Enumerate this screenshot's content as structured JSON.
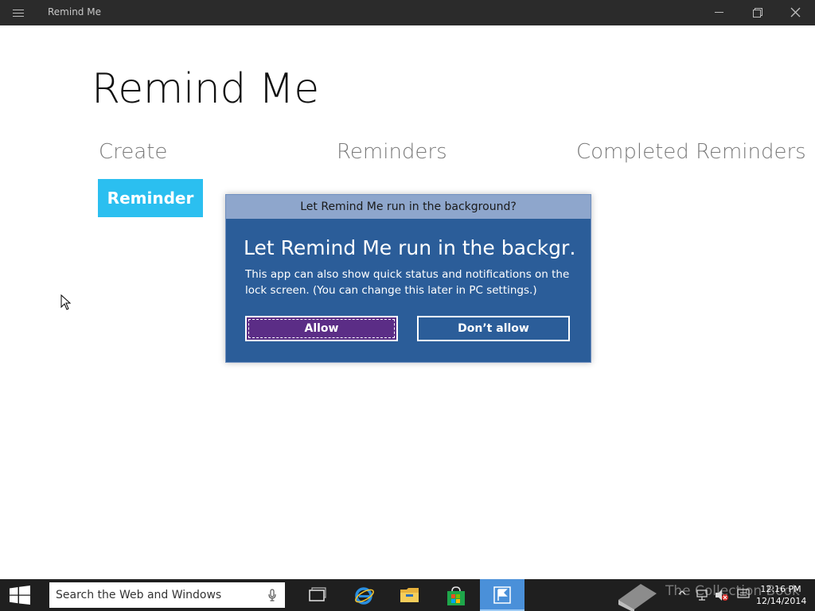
{
  "window": {
    "title": "Remind Me"
  },
  "app": {
    "heading": "Remind Me",
    "sections": [
      "Create",
      "Reminders",
      "Completed Reminders"
    ],
    "reminder_button": "Reminder",
    "accent": "#2bbff0"
  },
  "dialog": {
    "title": "Let Remind Me run in the background?",
    "heading": "Let Remind Me run in the backgr…",
    "body": "This app can also show quick status and notifications on the lock screen. (You can change this later in PC settings.)",
    "allow_label": "Allow",
    "deny_label": "Don’t allow",
    "bg_color": "#2b5d99",
    "allow_color": "#5b2d86"
  },
  "taskbar": {
    "search_placeholder": "Search the Web and Windows",
    "watermark": "The Collection Book",
    "time": "12:16 PM",
    "date": "12/14/2014",
    "icons": [
      "task-view-icon",
      "internet-explorer-icon",
      "file-explorer-icon",
      "store-icon",
      "remind-me-app-icon"
    ]
  }
}
